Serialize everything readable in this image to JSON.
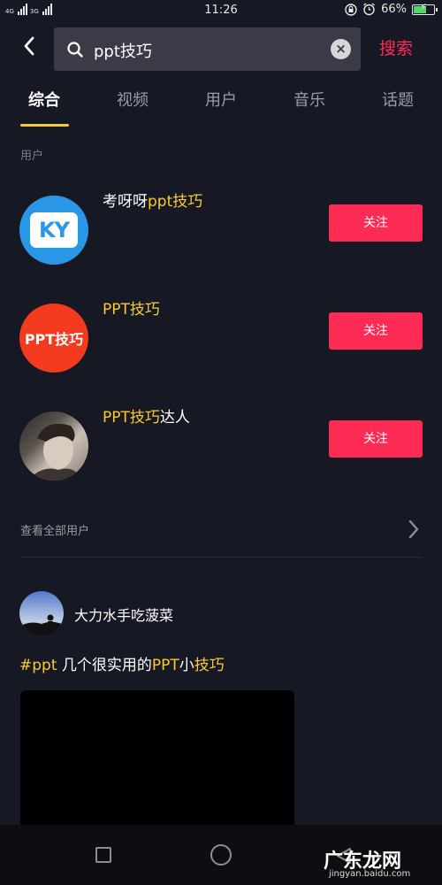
{
  "status_bar": {
    "network_1": "4G",
    "network_2": "3G",
    "time": "11:26",
    "battery_percent": "66%",
    "battery_level": 0.66
  },
  "search": {
    "query": "ppt技巧",
    "submit_label": "搜索"
  },
  "tabs": [
    {
      "label": "综合",
      "active": true
    },
    {
      "label": "视频",
      "active": false
    },
    {
      "label": "用户",
      "active": false
    },
    {
      "label": "音乐",
      "active": false
    },
    {
      "label": "话题",
      "active": false
    }
  ],
  "users_section": {
    "label": "用户",
    "users": [
      {
        "name_pre": "考呀呀",
        "name_hl": "ppt技巧",
        "name_post": "",
        "follow_label": "关注",
        "avatar_text": "KY",
        "avatar_color": "#2a97e6"
      },
      {
        "name_pre": "",
        "name_hl": "PPT技巧",
        "name_post": "",
        "follow_label": "关注",
        "avatar_text": "PPT技巧",
        "avatar_color": "#f43a1f"
      },
      {
        "name_pre": "",
        "name_hl": "PPT技巧",
        "name_post": "达人",
        "follow_label": "关注",
        "avatar_text": "",
        "avatar_color": "#5a534e"
      }
    ],
    "see_all_label": "查看全部用户"
  },
  "post": {
    "author": "大力水手吃菠菜",
    "title_hashtag": "#ppt",
    "title_mid": " 几个很实用的",
    "title_hl1": "PPT",
    "title_mid2": "小",
    "title_hl2": "技巧"
  },
  "watermark": {
    "text": "广东龙网",
    "sub": "jingyan.baidu.com"
  },
  "colors": {
    "background": "#161823",
    "accent_red": "#fe2c55",
    "highlight_yellow": "#facb2c"
  }
}
